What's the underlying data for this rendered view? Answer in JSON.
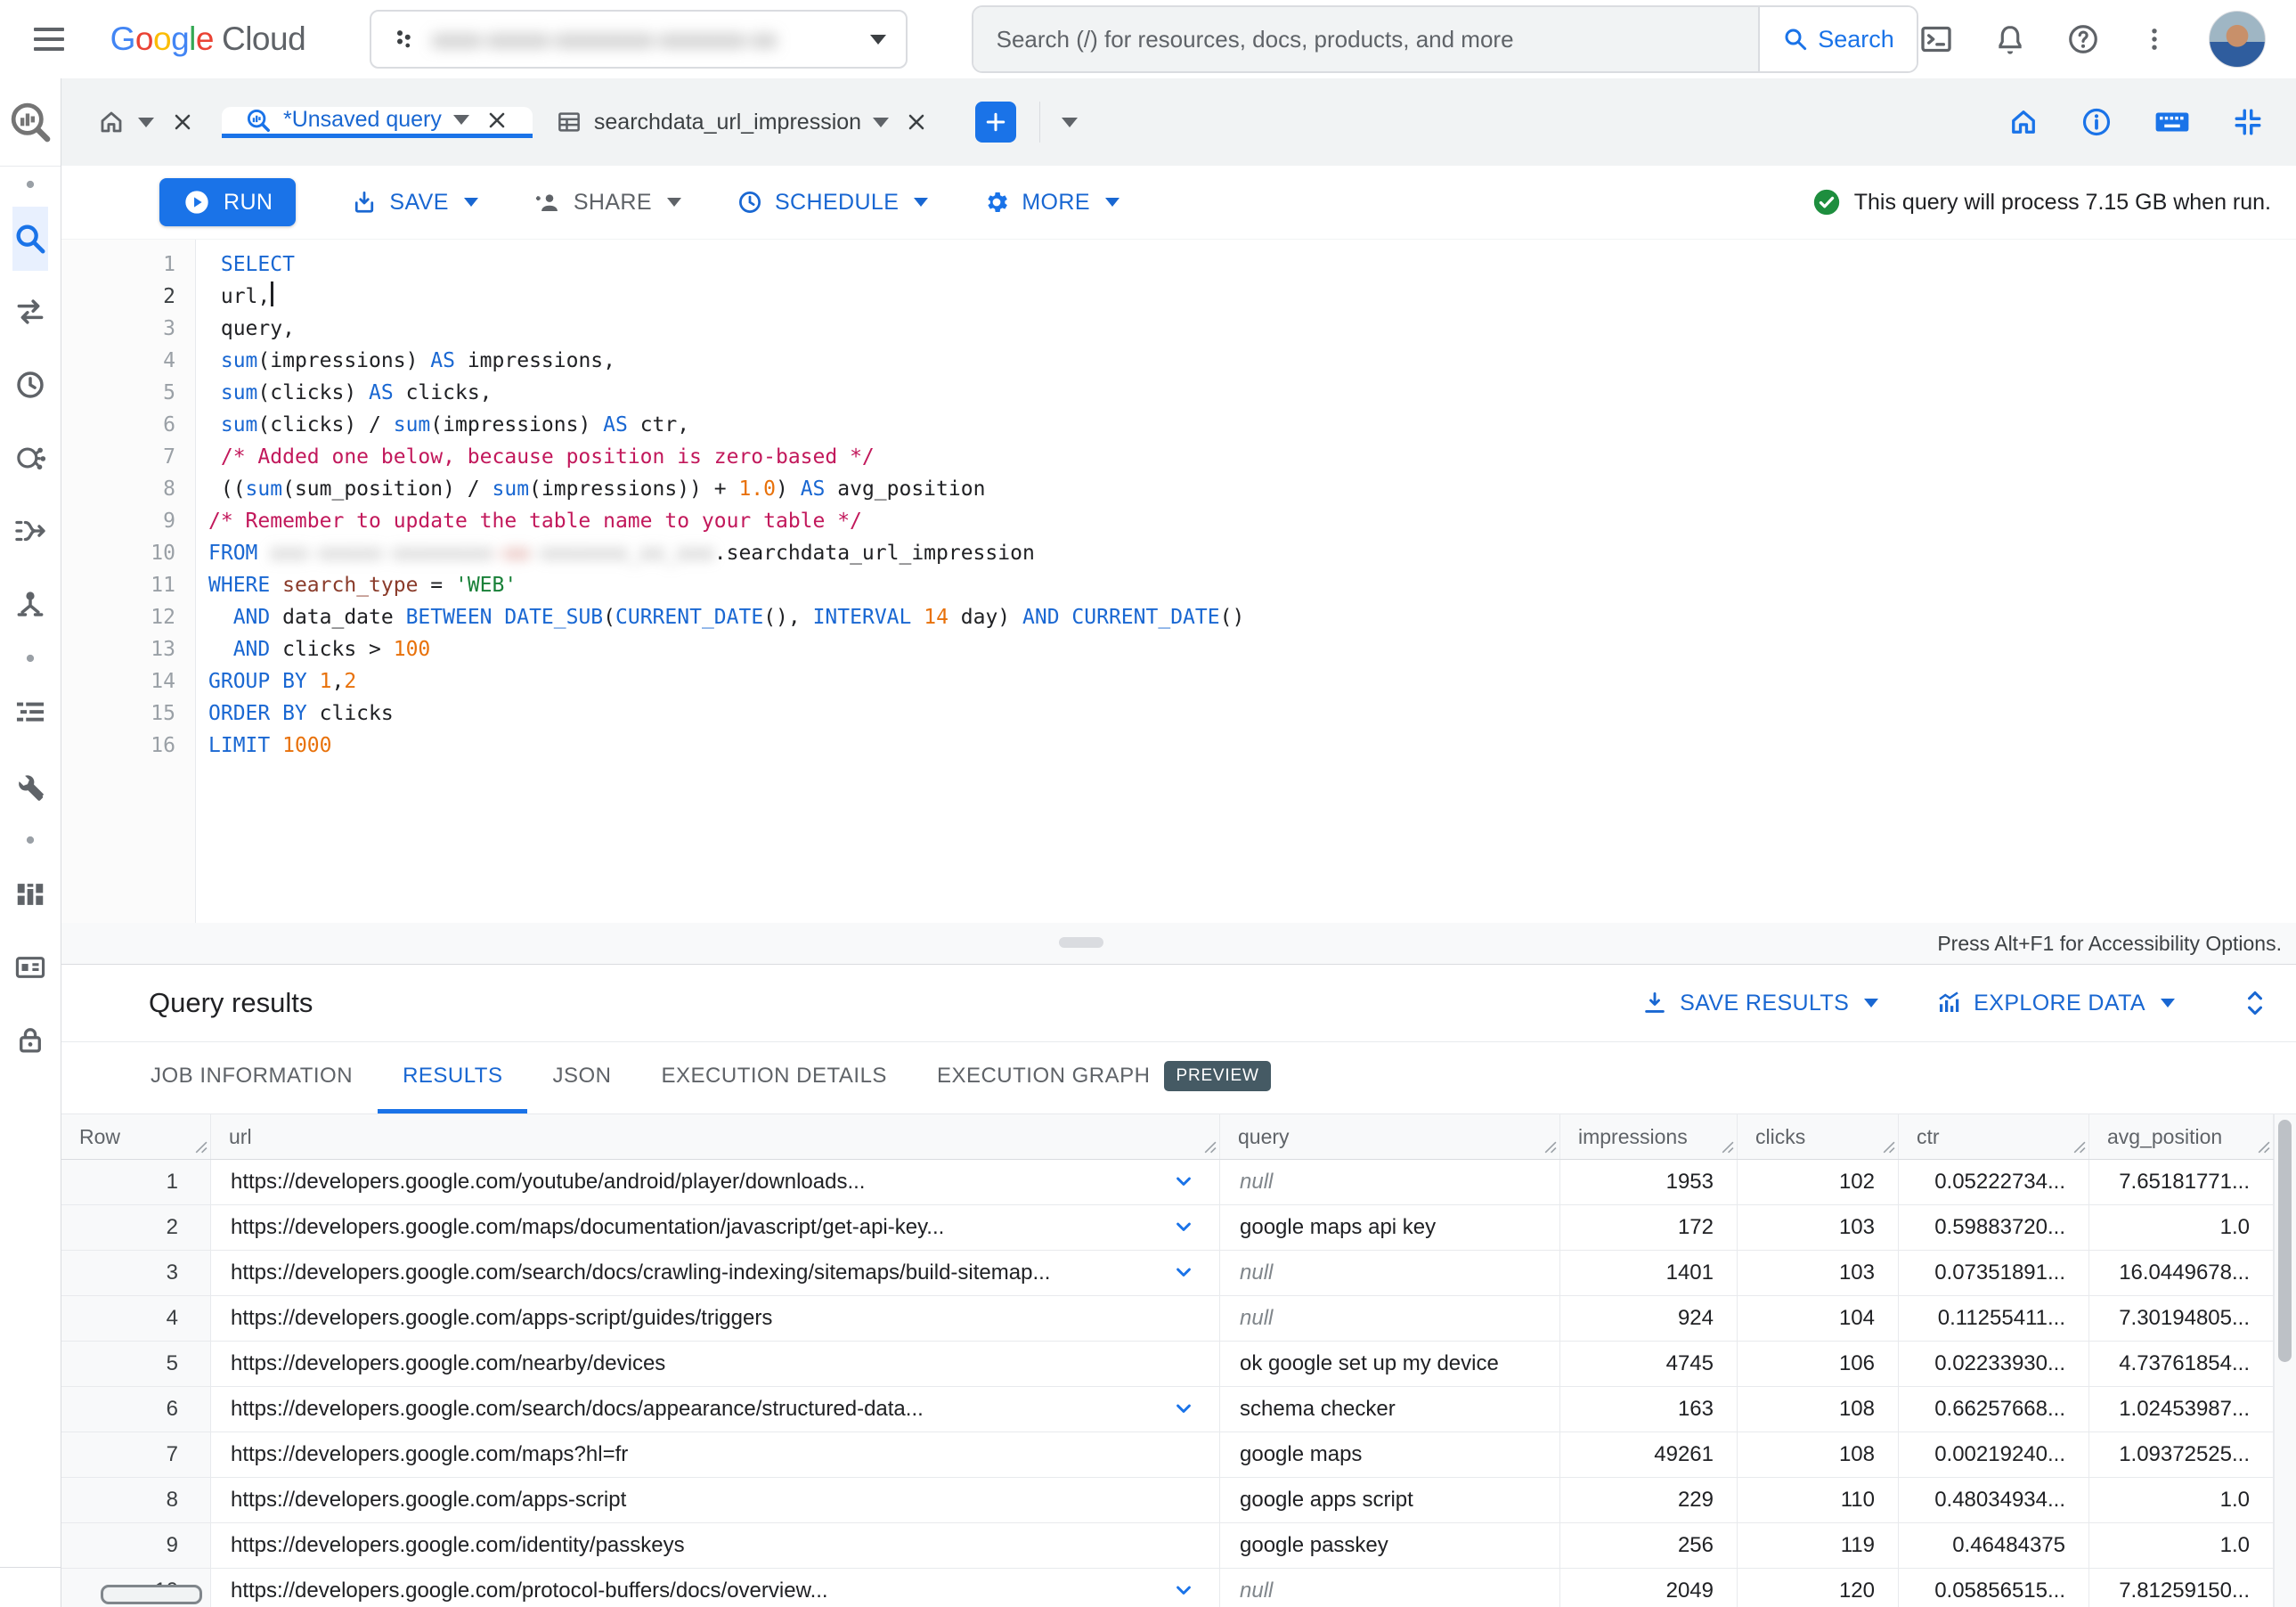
{
  "topbar": {
    "product": {
      "google": "Google",
      "cloud": "Cloud"
    },
    "project_selector_blurred_text": "xxxx-xxxxx-xxxxxxxx-xxxxxxx-xx",
    "search": {
      "placeholder": "Search (/) for resources, docs, products, and more",
      "button_label": "Search"
    }
  },
  "workspace_tabs": {
    "unsaved_query_label": "*Unsaved query",
    "table_tab_label": "searchdata_url_impression"
  },
  "toolbar": {
    "run_label": "RUN",
    "save_label": "SAVE",
    "share_label": "SHARE",
    "schedule_label": "SCHEDULE",
    "more_label": "MORE",
    "process_note": "This query will process 7.15 GB when run."
  },
  "editor": {
    "active_line": 2,
    "accessibility_note": "Press Alt+F1 for Accessibility Options.",
    "lines": [
      [
        [
          "kw",
          " SELECT"
        ]
      ],
      [
        [
          "id",
          " url,"
        ],
        [
          "caret",
          ""
        ]
      ],
      [
        [
          "id",
          " query,"
        ]
      ],
      [
        [
          "id",
          " "
        ],
        [
          "kw",
          "sum"
        ],
        [
          "id",
          "(impressions) "
        ],
        [
          "kw",
          "AS"
        ],
        [
          "id",
          " impressions,"
        ]
      ],
      [
        [
          "id",
          " "
        ],
        [
          "kw",
          "sum"
        ],
        [
          "id",
          "(clicks) "
        ],
        [
          "kw",
          "AS"
        ],
        [
          "id",
          " clicks,"
        ]
      ],
      [
        [
          "id",
          " "
        ],
        [
          "kw",
          "sum"
        ],
        [
          "id",
          "(clicks) / "
        ],
        [
          "kw",
          "sum"
        ],
        [
          "id",
          "(impressions) "
        ],
        [
          "kw",
          "AS"
        ],
        [
          "id",
          " ctr,"
        ]
      ],
      [
        [
          "id",
          " "
        ],
        [
          "com",
          "/* Added one below, because position is zero-based */"
        ]
      ],
      [
        [
          "id",
          " (("
        ],
        [
          "kw",
          "sum"
        ],
        [
          "id",
          "(sum_position) / "
        ],
        [
          "kw",
          "sum"
        ],
        [
          "id",
          "(impressions)) + "
        ],
        [
          "num",
          "1.0"
        ],
        [
          "id",
          ") "
        ],
        [
          "kw",
          "AS"
        ],
        [
          "id",
          " avg_position"
        ]
      ],
      [
        [
          "com",
          "/* Remember to update the table name to your table */"
        ]
      ],
      [
        [
          "kw",
          "FROM"
        ],
        [
          "id",
          " "
        ],
        [
          "blur",
          "xxx-xxxxx-xxxxxxxx"
        ],
        [
          "blur2",
          "-xx"
        ],
        [
          "blur",
          "-xxxxxxx_xx_xxx"
        ],
        [
          "id",
          ".searchdata_url_impression"
        ]
      ],
      [
        [
          "kw",
          "WHERE"
        ],
        [
          "id",
          " "
        ],
        [
          "fld",
          "search_type"
        ],
        [
          "id",
          " = "
        ],
        [
          "str",
          "'WEB'"
        ]
      ],
      [
        [
          "id",
          "  "
        ],
        [
          "kw",
          "AND"
        ],
        [
          "id",
          " data_date "
        ],
        [
          "kw",
          "BETWEEN"
        ],
        [
          "id",
          " "
        ],
        [
          "kw",
          "DATE_SUB"
        ],
        [
          "id",
          "("
        ],
        [
          "kw",
          "CURRENT_DATE"
        ],
        [
          "id",
          "(), "
        ],
        [
          "kw",
          "INTERVAL"
        ],
        [
          "id",
          " "
        ],
        [
          "num",
          "14"
        ],
        [
          "id",
          " day) "
        ],
        [
          "kw",
          "AND"
        ],
        [
          "id",
          " "
        ],
        [
          "kw",
          "CURRENT_DATE"
        ],
        [
          "id",
          "()"
        ]
      ],
      [
        [
          "id",
          "  "
        ],
        [
          "kw",
          "AND"
        ],
        [
          "id",
          " clicks > "
        ],
        [
          "num",
          "100"
        ]
      ],
      [
        [
          "kw",
          "GROUP BY"
        ],
        [
          "id",
          " "
        ],
        [
          "num",
          "1"
        ],
        [
          "id",
          ","
        ],
        [
          "num",
          "2"
        ]
      ],
      [
        [
          "kw",
          "ORDER BY"
        ],
        [
          "id",
          " clicks"
        ]
      ],
      [
        [
          "kw",
          "LIMIT"
        ],
        [
          "id",
          " "
        ],
        [
          "num",
          "1000"
        ]
      ]
    ]
  },
  "results": {
    "title": "Query results",
    "actions": {
      "save_results": "SAVE RESULTS",
      "explore_data": "EXPLORE DATA"
    },
    "tabs": [
      {
        "label": "JOB INFORMATION",
        "active": false
      },
      {
        "label": "RESULTS",
        "active": true
      },
      {
        "label": "JSON",
        "active": false
      },
      {
        "label": "EXECUTION DETAILS",
        "active": false
      },
      {
        "label": "EXECUTION GRAPH",
        "active": false,
        "badge": "PREVIEW"
      }
    ],
    "table": {
      "columns": [
        {
          "label": "Row",
          "key": "row",
          "align": "rownum"
        },
        {
          "label": "url",
          "key": "url",
          "align": "left"
        },
        {
          "label": "query",
          "key": "query",
          "align": "left"
        },
        {
          "label": "impressions",
          "key": "impressions",
          "align": "right"
        },
        {
          "label": "clicks",
          "key": "clicks",
          "align": "right"
        },
        {
          "label": "ctr",
          "key": "ctr",
          "align": "right"
        },
        {
          "label": "avg_position",
          "key": "avg_position",
          "align": "right"
        }
      ],
      "rows": [
        {
          "row": 1,
          "url": "https://developers.google.com/youtube/android/player/downloads...",
          "expand": true,
          "query": null,
          "impressions": "1953",
          "clicks": "102",
          "ctr": "0.05222734...",
          "avg_position": "7.65181771..."
        },
        {
          "row": 2,
          "url": "https://developers.google.com/maps/documentation/javascript/get-api-key...",
          "expand": true,
          "query": "google maps api key",
          "impressions": "172",
          "clicks": "103",
          "ctr": "0.59883720...",
          "avg_position": "1.0"
        },
        {
          "row": 3,
          "url": "https://developers.google.com/search/docs/crawling-indexing/sitemaps/build-sitemap...",
          "expand": true,
          "query": null,
          "impressions": "1401",
          "clicks": "103",
          "ctr": "0.07351891...",
          "avg_position": "16.0449678..."
        },
        {
          "row": 4,
          "url": "https://developers.google.com/apps-script/guides/triggers",
          "expand": false,
          "query": null,
          "impressions": "924",
          "clicks": "104",
          "ctr": "0.11255411...",
          "avg_position": "7.30194805..."
        },
        {
          "row": 5,
          "url": "https://developers.google.com/nearby/devices",
          "expand": false,
          "query": "ok google set up my device",
          "impressions": "4745",
          "clicks": "106",
          "ctr": "0.02233930...",
          "avg_position": "4.73761854..."
        },
        {
          "row": 6,
          "url": "https://developers.google.com/search/docs/appearance/structured-data...",
          "expand": true,
          "query": "schema checker",
          "impressions": "163",
          "clicks": "108",
          "ctr": "0.66257668...",
          "avg_position": "1.02453987..."
        },
        {
          "row": 7,
          "url": "https://developers.google.com/maps?hl=fr",
          "expand": false,
          "query": "google maps",
          "impressions": "49261",
          "clicks": "108",
          "ctr": "0.00219240...",
          "avg_position": "1.09372525..."
        },
        {
          "row": 8,
          "url": "https://developers.google.com/apps-script",
          "expand": false,
          "query": "google apps script",
          "impressions": "229",
          "clicks": "110",
          "ctr": "0.48034934...",
          "avg_position": "1.0"
        },
        {
          "row": 9,
          "url": "https://developers.google.com/identity/passkeys",
          "expand": false,
          "query": "google passkey",
          "impressions": "256",
          "clicks": "119",
          "ctr": "0.46484375",
          "avg_position": "1.0"
        },
        {
          "row": 10,
          "url": "https://developers.google.com/protocol-buffers/docs/overview...",
          "expand": true,
          "query": null,
          "impressions": "2049",
          "clicks": "120",
          "ctr": "0.05856515...",
          "avg_position": "7.81259150..."
        }
      ]
    }
  },
  "sidebar": {
    "items": [
      {
        "icon": "dot",
        "name": "separator-dot"
      },
      {
        "icon": "search",
        "name": "bigquery-studio-search",
        "active": true
      },
      {
        "icon": "transfers",
        "name": "data-transfers"
      },
      {
        "icon": "clock",
        "name": "scheduled-queries"
      },
      {
        "icon": "hub",
        "name": "analytics-hub"
      },
      {
        "icon": "migration",
        "name": "migration"
      },
      {
        "icon": "dataform",
        "name": "dataform"
      },
      {
        "icon": "dot",
        "name": "separator-dot"
      },
      {
        "icon": "list",
        "name": "capacity-management"
      },
      {
        "icon": "wrench",
        "name": "administration"
      },
      {
        "icon": "dot",
        "name": "separator-dot"
      },
      {
        "icon": "bi",
        "name": "bi-engine"
      },
      {
        "icon": "card",
        "name": "connections"
      },
      {
        "icon": "lock",
        "name": "governance"
      }
    ]
  }
}
